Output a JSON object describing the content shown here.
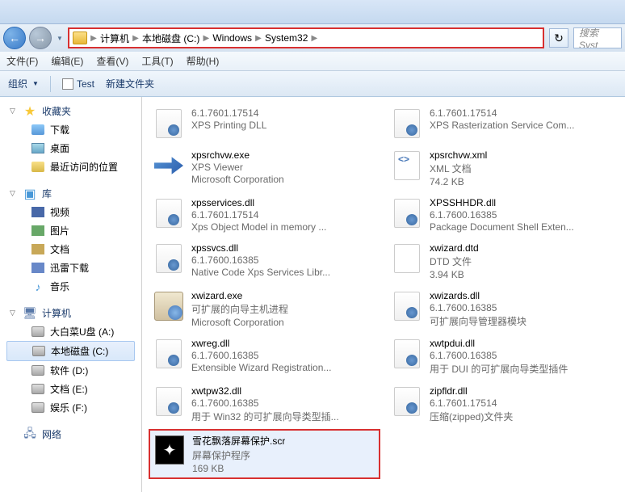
{
  "breadcrumb": {
    "items": [
      "计算机",
      "本地磁盘 (C:)",
      "Windows",
      "System32"
    ]
  },
  "search": {
    "placeholder": "搜索 Syst"
  },
  "menu": {
    "file": "文件(F)",
    "edit": "编辑(E)",
    "view": "查看(V)",
    "tools": "工具(T)",
    "help": "帮助(H)"
  },
  "toolbar": {
    "organize": "组织",
    "test": "Test",
    "new_folder": "新建文件夹"
  },
  "sidebar": {
    "favorites": {
      "label": "收藏夹",
      "children": [
        {
          "label": "下载",
          "icon": "download"
        },
        {
          "label": "桌面",
          "icon": "desktop"
        },
        {
          "label": "最近访问的位置",
          "icon": "recent"
        }
      ]
    },
    "libraries": {
      "label": "库",
      "children": [
        {
          "label": "视频",
          "icon": "video"
        },
        {
          "label": "图片",
          "icon": "picture"
        },
        {
          "label": "文档",
          "icon": "document"
        },
        {
          "label": "迅雷下载",
          "icon": "download2"
        },
        {
          "label": "音乐",
          "icon": "music"
        }
      ]
    },
    "computer": {
      "label": "计算机",
      "children": [
        {
          "label": "大白菜U盘 (A:)",
          "icon": "drive"
        },
        {
          "label": "本地磁盘 (C:)",
          "icon": "drive",
          "selected": true
        },
        {
          "label": "软件 (D:)",
          "icon": "drive"
        },
        {
          "label": "文档 (E:)",
          "icon": "drive"
        },
        {
          "label": "娱乐 (F:)",
          "icon": "drive"
        }
      ]
    },
    "network": {
      "label": "网络"
    }
  },
  "files": [
    {
      "name": "",
      "line2": "6.1.7601.17514",
      "line3": "XPS Printing DLL",
      "icon": "dll"
    },
    {
      "name": "",
      "line2": "6.1.7601.17514",
      "line3": "XPS Rasterization Service Com...",
      "icon": "dll"
    },
    {
      "name": "xpsrchvw.exe",
      "line2": "XPS Viewer",
      "line3": "Microsoft Corporation",
      "icon": "exe-arrow"
    },
    {
      "name": "xpsrchvw.xml",
      "line2": "XML 文档",
      "line3": "74.2 KB",
      "icon": "xml"
    },
    {
      "name": "xpsservices.dll",
      "line2": "6.1.7601.17514",
      "line3": "Xps Object Model in memory ...",
      "icon": "dll"
    },
    {
      "name": "XPSSHHDR.dll",
      "line2": "6.1.7600.16385",
      "line3": "Package Document Shell Exten...",
      "icon": "dll"
    },
    {
      "name": "xpssvcs.dll",
      "line2": "6.1.7600.16385",
      "line3": "Native Code Xps Services Libr...",
      "icon": "dll"
    },
    {
      "name": "xwizard.dtd",
      "line2": "DTD 文件",
      "line3": "3.94 KB",
      "icon": "dtd"
    },
    {
      "name": "xwizard.exe",
      "line2": "可扩展的向导主机进程",
      "line3": "Microsoft Corporation",
      "icon": "wiz"
    },
    {
      "name": "xwizards.dll",
      "line2": "6.1.7600.16385",
      "line3": "可扩展向导管理器模块",
      "icon": "dll"
    },
    {
      "name": "xwreg.dll",
      "line2": "6.1.7600.16385",
      "line3": "Extensible Wizard Registration...",
      "icon": "dll"
    },
    {
      "name": "xwtpdui.dll",
      "line2": "6.1.7600.16385",
      "line3": "用于 DUI 的可扩展向导类型插件",
      "icon": "dll"
    },
    {
      "name": "xwtpw32.dll",
      "line2": "6.1.7600.16385",
      "line3": "用于 Win32 的可扩展向导类型插...",
      "icon": "dll"
    },
    {
      "name": "zipfldr.dll",
      "line2": "6.1.7601.17514",
      "line3": "压缩(zipped)文件夹",
      "icon": "dll"
    },
    {
      "name": "雪花飘落屏幕保护.scr",
      "line2": "屏幕保护程序",
      "line3": "169 KB",
      "icon": "scr",
      "selected": true
    }
  ]
}
